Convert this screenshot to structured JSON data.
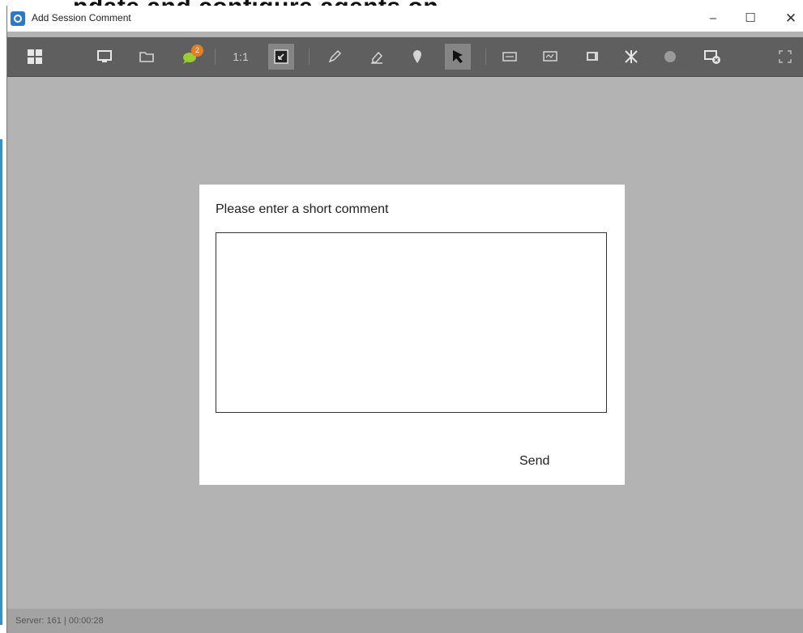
{
  "background": {
    "cropped_text": "pdate and configure agents on"
  },
  "window": {
    "title": "Add Session Comment"
  },
  "titlebar_controls": {
    "minimize": "–",
    "maximize": "☐",
    "close": "✕"
  },
  "toolbar": {
    "icons": [
      "grid-icon",
      "monitor-icon",
      "folder-icon",
      "chat-icon",
      "fit-screen-icon",
      "pencil-icon",
      "eraser-icon",
      "pin-icon",
      "pointer-icon",
      "keyboard-icon",
      "screen-icon",
      "window-icon",
      "tools-icon",
      "record-icon",
      "disconnect-icon",
      "fullscreen-icon"
    ],
    "chat_badge": "2",
    "zoom_label": "1:1"
  },
  "dialog": {
    "prompt": "Please enter a short comment",
    "comment_value": "",
    "send_label": "Send"
  },
  "statusbar": {
    "text": "Server: 161 | 00:00:28"
  },
  "colors": {
    "toolbar": "#5f5f5f",
    "workspace": "#b3b3b3",
    "badge": "#e67e22",
    "app_icon": "#2c79c8"
  }
}
